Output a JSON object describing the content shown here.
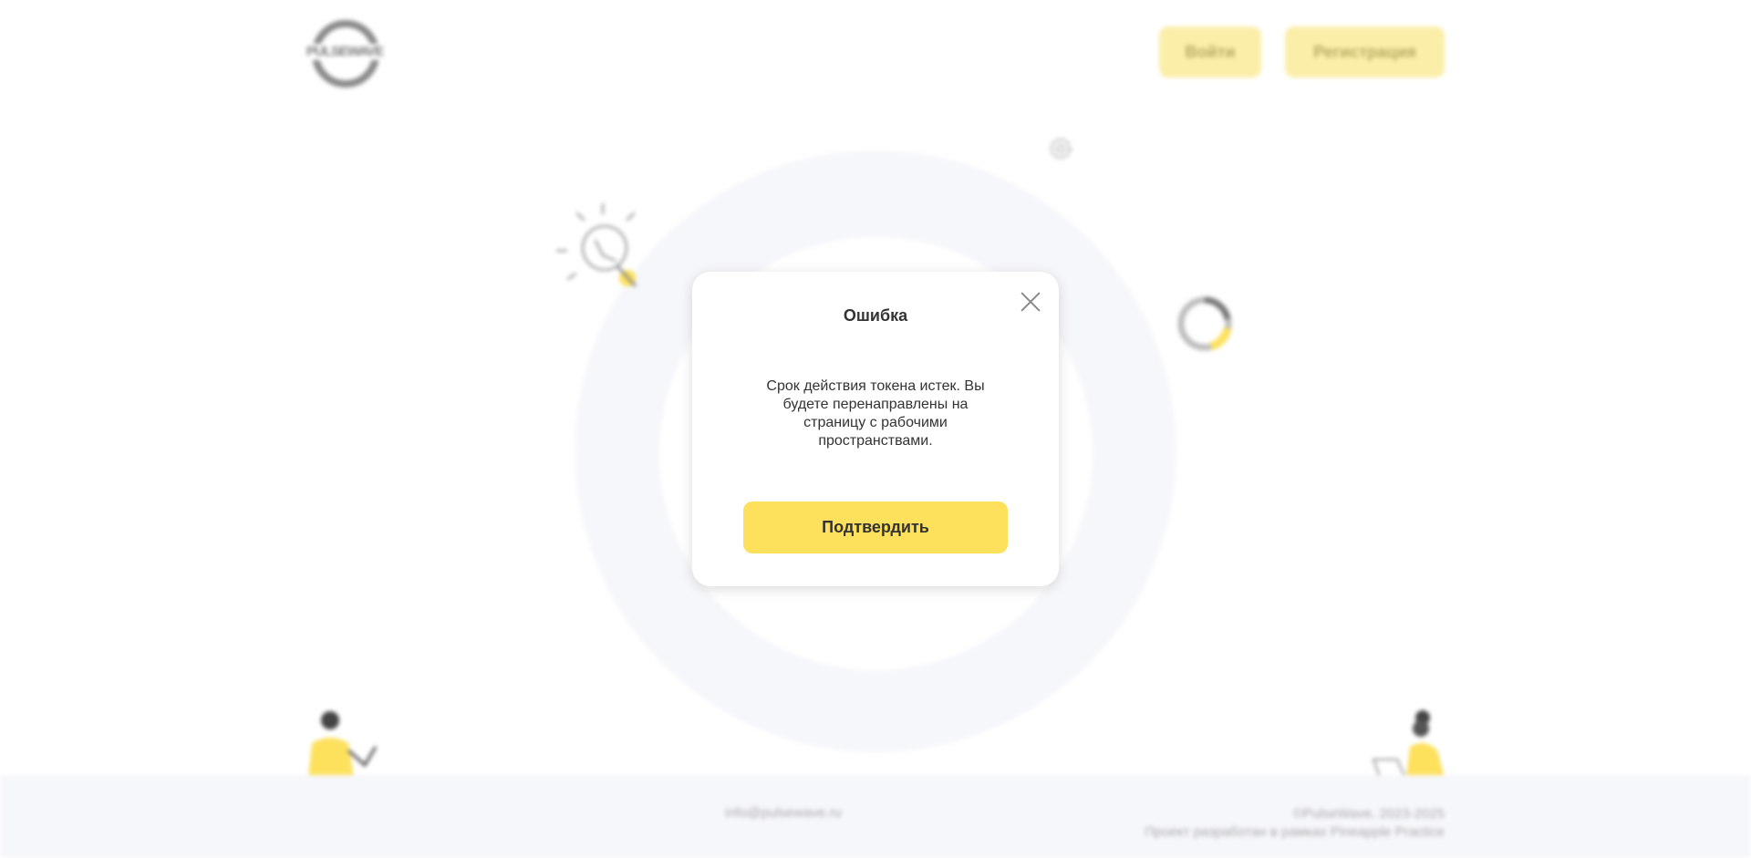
{
  "header": {
    "logo_text": "PULSEWAVE",
    "login_label": "Войти",
    "register_label": "Регистрация"
  },
  "modal": {
    "title": "Ошибка",
    "message": "Срок действия токена истек. Вы будете перенаправлены на страницу с рабочими пространствами.",
    "confirm_label": "Подтвердить"
  },
  "footer": {
    "email": "info@pulsewave.ru",
    "copyright": "©PulseWave, 2023-2025",
    "project_note": "Проект разработан в рамках Pineapple Practice"
  },
  "icons": {
    "lightbulb": "lightbulb-icon",
    "gear": "gear-icon",
    "donut_chart": "donut-chart-icon",
    "person_left": "man-illustration",
    "person_right": "woman-laptop-illustration",
    "close": "close-icon"
  },
  "colors": {
    "accent": "#fde05c",
    "accent_faded": "#fbeea8",
    "background_tint": "#f6f7fb",
    "text": "#333333",
    "muted_text": "#a9a9a9"
  }
}
